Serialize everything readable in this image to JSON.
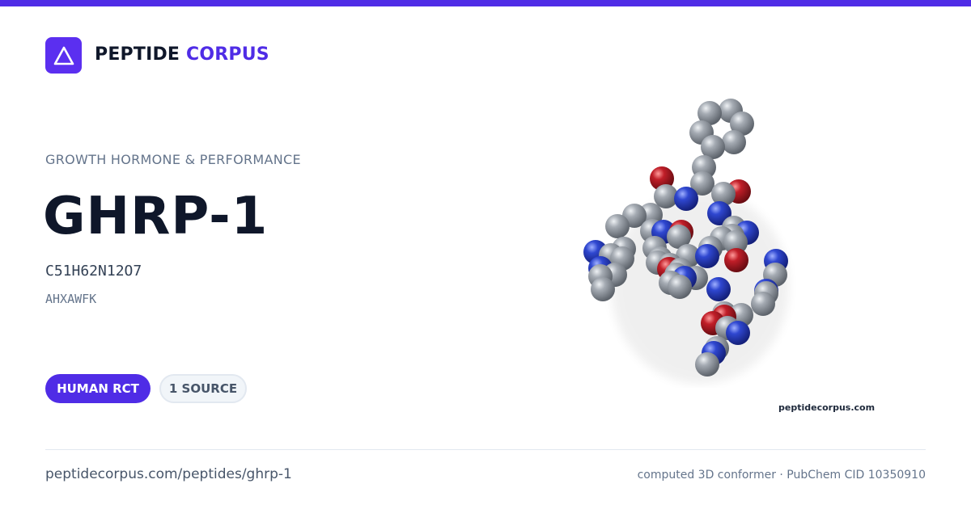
{
  "brand": {
    "name_part1": "PEPTIDE",
    "name_part2": "CORPUS",
    "accent_color": "#4f2ce6",
    "logo_icon": "triangle-icon"
  },
  "peptide": {
    "category": "GROWTH HORMONE & PERFORMANCE",
    "name": "GHRP-1",
    "formula": "C51H62N12O7",
    "sequence": "AHXAWFK"
  },
  "badges": {
    "evidence": "HUMAN RCT",
    "sources": "1 SOURCE"
  },
  "molecule": {
    "icon": "molecule-3d-model",
    "watermark": "peptidecorpus.com",
    "atom_colors": {
      "carbon": "#8a9099",
      "nitrogen": "#2438b8",
      "oxygen": "#a5161f"
    }
  },
  "footer": {
    "url": "peptidecorpus.com/peptides/ghrp-1",
    "meta": "computed 3D conformer · PubChem CID 10350910"
  }
}
